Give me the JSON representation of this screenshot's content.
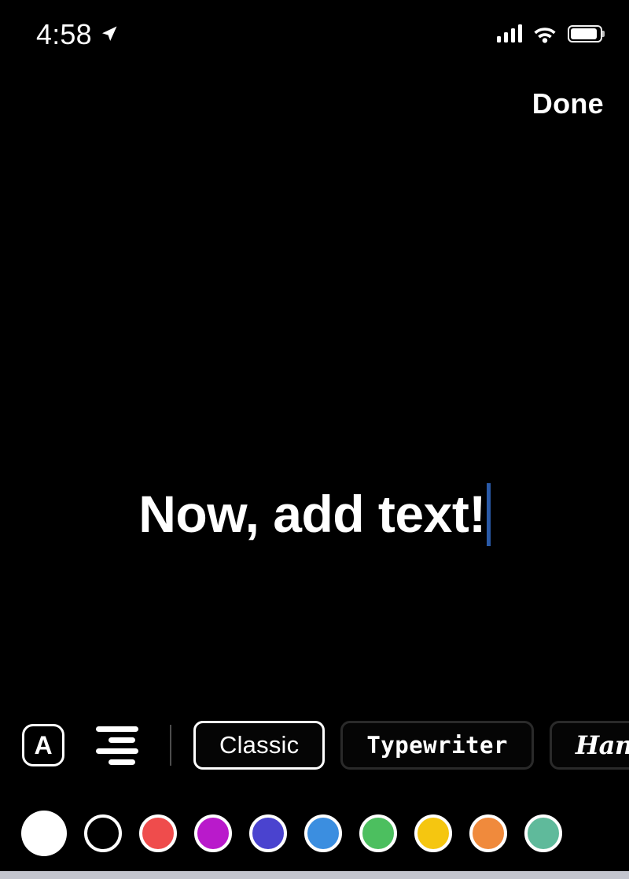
{
  "status_bar": {
    "time": "4:58",
    "location_icon": "location-arrow-icon",
    "signal_icon": "cellular-signal-icon",
    "wifi_icon": "wifi-icon",
    "battery_icon": "battery-icon"
  },
  "top_bar": {
    "done_label": "Done"
  },
  "canvas": {
    "text_value": "Now, add text!",
    "caret_color": "#2a5aa8",
    "text_color": "#ffffff"
  },
  "toolbar": {
    "letter_case_label": "A",
    "letter_case_icon": "letter-a-box-icon",
    "align_icon": "text-align-icon",
    "fonts": [
      {
        "label": "Classic",
        "style": "classic",
        "selected": true
      },
      {
        "label": "Typewriter",
        "style": "typewriter",
        "selected": false
      },
      {
        "label": "Handwriting",
        "style": "handwriting",
        "selected": false
      }
    ]
  },
  "colors": {
    "swatches": [
      {
        "name": "white",
        "hex": "#ffffff",
        "selected": true
      },
      {
        "name": "black",
        "hex": "#000000",
        "selected": false
      },
      {
        "name": "red",
        "hex": "#ef4c4c",
        "selected": false
      },
      {
        "name": "magenta",
        "hex": "#b91acb",
        "selected": false
      },
      {
        "name": "indigo",
        "hex": "#4a43cf",
        "selected": false
      },
      {
        "name": "blue",
        "hex": "#3b8ee0",
        "selected": false
      },
      {
        "name": "green",
        "hex": "#4cbf5f",
        "selected": false
      },
      {
        "name": "yellow",
        "hex": "#f5c610",
        "selected": false
      },
      {
        "name": "orange",
        "hex": "#f08a3c",
        "selected": false
      },
      {
        "name": "teal",
        "hex": "#5fba9b",
        "selected": false
      }
    ]
  },
  "home_indicator": {
    "color": "#c3c5ce"
  }
}
